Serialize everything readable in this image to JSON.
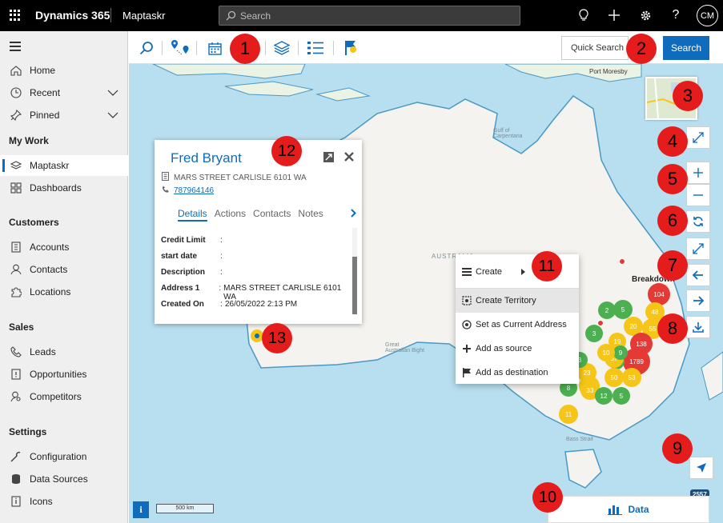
{
  "topbar": {
    "brand": "Dynamics 365",
    "app": "Maptaskr",
    "search_placeholder": "Search",
    "user_initials": "CM"
  },
  "nav": {
    "items_top": [
      {
        "label": "Home",
        "icon": "home-icon"
      },
      {
        "label": "Recent",
        "icon": "clock-icon"
      },
      {
        "label": "Pinned",
        "icon": "pin-icon"
      }
    ],
    "section_mywork": "My Work",
    "mywork": [
      {
        "label": "Maptaskr",
        "icon": "layers-icon"
      },
      {
        "label": "Dashboards",
        "icon": "dashboard-icon"
      }
    ],
    "section_customers": "Customers",
    "customers": [
      {
        "label": "Accounts",
        "icon": "building-icon"
      },
      {
        "label": "Contacts",
        "icon": "person-icon"
      },
      {
        "label": "Locations",
        "icon": "puzzle-icon"
      }
    ],
    "section_sales": "Sales",
    "sales": [
      {
        "label": "Leads",
        "icon": "phone-icon"
      },
      {
        "label": "Opportunities",
        "icon": "document-icon"
      },
      {
        "label": "Competitors",
        "icon": "person-search-icon"
      }
    ],
    "section_settings": "Settings",
    "settings": [
      {
        "label": "Configuration",
        "icon": "wrench-icon"
      },
      {
        "label": "Data Sources",
        "icon": "database-icon"
      },
      {
        "label": "Icons",
        "icon": "icon-file-icon"
      }
    ]
  },
  "toolbar": {
    "quick_search_label": "Quick Search",
    "search_button": "Search"
  },
  "callouts": [
    "1",
    "2",
    "3",
    "4",
    "5",
    "6",
    "7",
    "8",
    "9",
    "10",
    "11",
    "12",
    "13"
  ],
  "card": {
    "name": "Fred Bryant",
    "address": "MARS STREET CARLISLE 6101 WA",
    "phone": "787964146",
    "tabs": [
      "Details",
      "Actions",
      "Contacts",
      "Notes"
    ],
    "fields": [
      {
        "label": "Credit Limit",
        "value": ""
      },
      {
        "label": "start date",
        "value": ""
      },
      {
        "label": "Description",
        "value": ""
      },
      {
        "label": "Address 1",
        "value": "MARS STREET CARLISLE 6101 WA"
      },
      {
        "label": "Created On",
        "value": "26/05/2022 2:13 PM"
      }
    ]
  },
  "context_menu": {
    "create": "Create",
    "items": [
      "Create Territory",
      "Set as Current Address",
      "Add as source",
      "Add as destination"
    ]
  },
  "map": {
    "labels": [
      "Port Moresby",
      "Gulf of Carpentaria",
      "Breakdown",
      "AUSTRALIA",
      "Great Australian Bight",
      "Bass Strait"
    ],
    "scale": "500 km",
    "clusters": [
      "104",
      "2",
      "5",
      "3",
      "48",
      "20",
      "19",
      "55",
      "138",
      "1789",
      "9",
      "57",
      "23",
      "33",
      "50",
      "53",
      "8",
      "33",
      "5",
      "12",
      "11",
      "3",
      "9",
      "10"
    ],
    "record_count": "2557",
    "data_button": "Data",
    "info": "i"
  }
}
